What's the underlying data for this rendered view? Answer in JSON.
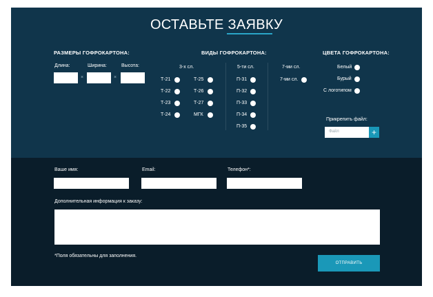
{
  "title": "ОСТАВЬТЕ ЗАЯВКУ",
  "sizes": {
    "heading": "РАЗМЕРЫ ГОФРОКАРТОНА:",
    "length_label": "Длина:",
    "width_label": "Ширина:",
    "height_label": "Высота:",
    "separator": "×"
  },
  "types": {
    "heading": "ВИДЫ ГОФРОКАРТОНА:",
    "col3_heading": "3-х сл.",
    "col5_heading": "5-ти сл.",
    "col7_heading": "7-ми сл.",
    "three_left": [
      "Т-21",
      "Т-22",
      "Т-23",
      "Т-24"
    ],
    "three_right": [
      "Т-25",
      "Т-26",
      "Т-27",
      "МГК"
    ],
    "five": [
      "П-31",
      "П-32",
      "П-33",
      "П-34",
      "П-35"
    ],
    "seven": [
      "7-ми сл."
    ]
  },
  "colors": {
    "heading": "ЦВЕТА ГОФРОКАРТОНА:",
    "options": [
      "Белый",
      "Бурый",
      "С логотипом"
    ]
  },
  "attach": {
    "label": "Прикрепить файл:",
    "placeholder": "Файл",
    "button": "+"
  },
  "contact": {
    "name_label": "Ваше имя:",
    "email_label": "Email:",
    "phone_label": "Телефон*:",
    "extra_label": "Дополнительная информация к заказу:",
    "note": "*Поля обязательны для заполнения.",
    "submit": "ОТПРАВИТЬ"
  },
  "palette": {
    "panel_top": "#10354b",
    "panel_bottom": "#0a1d2a",
    "accent": "#1a98b8"
  }
}
